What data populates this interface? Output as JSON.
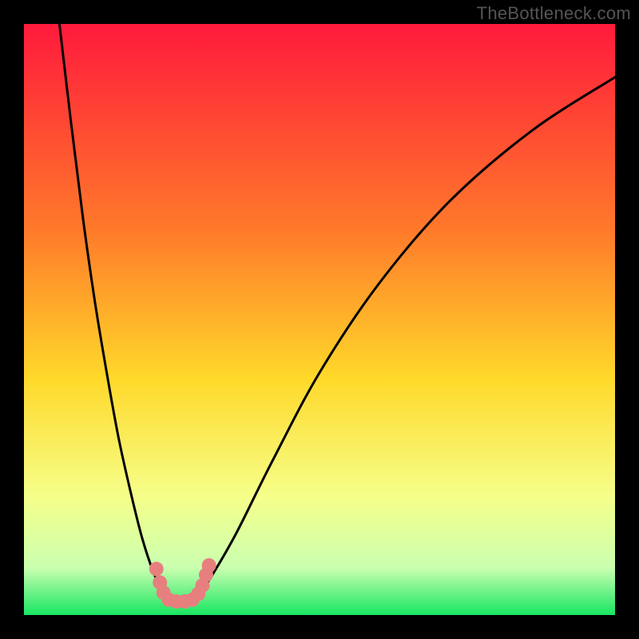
{
  "watermark": "TheBottleneck.com",
  "chart_data": {
    "type": "line",
    "title": "",
    "xlabel": "",
    "ylabel": "",
    "xlim": [
      0,
      100
    ],
    "ylim": [
      0,
      100
    ],
    "gradient_stops": [
      {
        "offset": 0,
        "color": "#ff1a3c"
      },
      {
        "offset": 35,
        "color": "#ff7a2a"
      },
      {
        "offset": 60,
        "color": "#ffd92a"
      },
      {
        "offset": 80,
        "color": "#f6ff8a"
      },
      {
        "offset": 92,
        "color": "#caffb0"
      },
      {
        "offset": 100,
        "color": "#17e661"
      }
    ],
    "series": [
      {
        "name": "bottleneck-curve",
        "color": "#000000",
        "x": [
          6,
          8,
          10,
          12,
          14,
          16,
          18,
          20,
          22,
          23.5,
          25,
          27,
          29,
          30,
          32,
          36,
          42,
          50,
          60,
          72,
          86,
          100
        ],
        "values": [
          100,
          83,
          67,
          53,
          41,
          30,
          21,
          13,
          7,
          4,
          2.5,
          2.2,
          2.8,
          4,
          7,
          14,
          26,
          41,
          56,
          70,
          82,
          91
        ]
      }
    ],
    "markers": {
      "color": "#e77f7f",
      "points": [
        {
          "x": 22.4,
          "y": 7.8
        },
        {
          "x": 23.0,
          "y": 5.5
        },
        {
          "x": 23.6,
          "y": 3.8
        },
        {
          "x": 24.5,
          "y": 2.6
        },
        {
          "x": 25.8,
          "y": 2.3
        },
        {
          "x": 27.2,
          "y": 2.3
        },
        {
          "x": 28.5,
          "y": 2.6
        },
        {
          "x": 29.5,
          "y": 3.6
        },
        {
          "x": 30.2,
          "y": 5.0
        },
        {
          "x": 30.8,
          "y": 6.8
        },
        {
          "x": 31.3,
          "y": 8.4
        }
      ]
    }
  }
}
